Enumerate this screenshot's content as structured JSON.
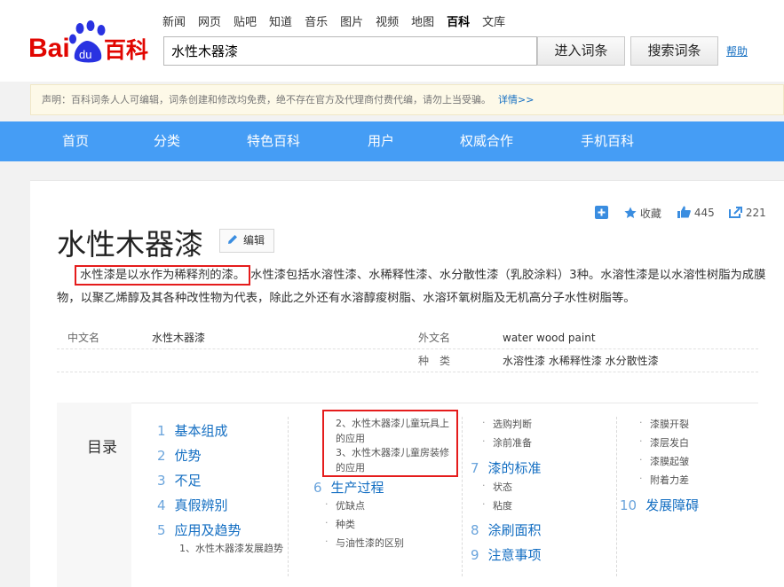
{
  "header": {
    "logo_text_bai": "Bai",
    "logo_text_du": "du",
    "logo_text_baike": "百科",
    "nav": [
      "新闻",
      "网页",
      "贴吧",
      "知道",
      "音乐",
      "图片",
      "视频",
      "地图",
      "百科",
      "文库"
    ],
    "nav_active": "百科",
    "search_value": "水性木器漆",
    "enter_label": "进入词条",
    "search_label": "搜索词条",
    "help_label": "帮助"
  },
  "notice": {
    "text": "声明：百科词条人人可编辑，词条创建和修改均免费，绝不存在官方及代理商付费代编，请勿上当受骗。",
    "detail": "详情>>"
  },
  "bluenav": [
    "首页",
    "分类",
    "特色百科",
    "用户",
    "权威合作",
    "手机百科"
  ],
  "actions": {
    "collect": "收藏",
    "like_count": "445",
    "share_count": "221"
  },
  "title": "水性木器漆",
  "edit_label": "编辑",
  "summary": {
    "lead": "水性漆是以水作为稀释剂的漆。",
    "rest": "水性漆包括水溶性漆、水稀释性漆、水分散性漆（乳胶涂料）3种。水溶性漆是以水溶性树脂为成膜物，以聚乙烯醇及其各种改性物为代表，除此之外还有水溶醇痠树脂、水溶环氧树脂及无机高分子水性树脂等。"
  },
  "basic_info": {
    "cn_name_key": "中文名",
    "cn_name_val": "水性木器漆",
    "en_name_key": "外文名",
    "en_name_val": "water wood paint",
    "type_key": "种　类",
    "type_val": "水溶性漆 水稀释性漆 水分散性漆"
  },
  "catalog": {
    "label": "目录",
    "col1": [
      {
        "num": "1",
        "label": "基本组成"
      },
      {
        "num": "2",
        "label": "优势"
      },
      {
        "num": "3",
        "label": "不足"
      },
      {
        "num": "4",
        "label": "真假辨别"
      },
      {
        "num": "5",
        "label": "应用及趋势"
      }
    ],
    "col1_sub": "1、水性木器漆发展趋势",
    "col2_sub_a": "2、水性木器漆儿童玩具上的应用",
    "col2_sub_b": "3、水性木器漆儿童房装修的应用",
    "col2_main": {
      "num": "6",
      "label": "生产过程"
    },
    "col2_subs": [
      "优缺点",
      "种类",
      "与油性漆的区别"
    ],
    "col3_subs_top": [
      "选购判断",
      "涂前准备"
    ],
    "col3_main_7": {
      "num": "7",
      "label": "漆的标准"
    },
    "col3_subs_mid": [
      "状态",
      "粘度"
    ],
    "col3_main_8": {
      "num": "8",
      "label": "涂刷面积"
    },
    "col3_main_9": {
      "num": "9",
      "label": "注意事项"
    },
    "col4_subs": [
      "漆膜开裂",
      "漆层发白",
      "漆膜起皱",
      "附着力差"
    ],
    "col4_main": {
      "num": "10",
      "label": "发展障碍"
    }
  }
}
